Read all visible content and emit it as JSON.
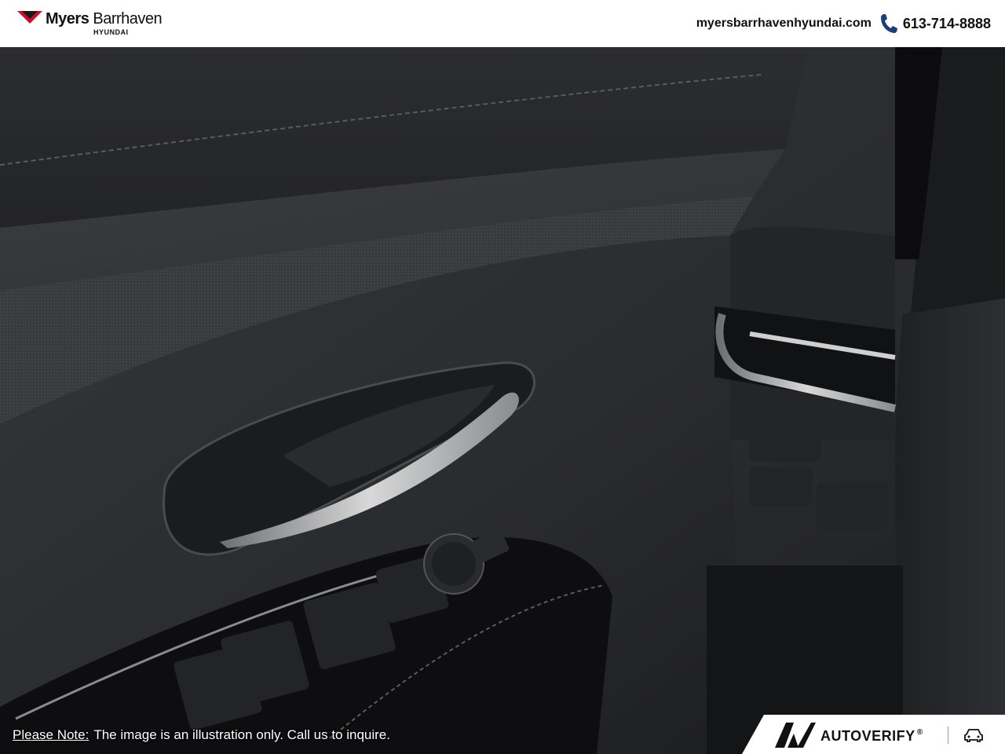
{
  "header": {
    "logo": {
      "name_bold": "Myers",
      "name_regular": "Barrhaven",
      "sub": "HYUNDAI"
    },
    "website": "myersbarrhavenhyundai.com",
    "phone": "613-714-8888",
    "phone_icon": "phone-icon"
  },
  "photo": {
    "subject": "car-interior-door-panel",
    "dominant_colors": [
      "#2a2b2e",
      "#3a3c40",
      "#b8b8b8"
    ]
  },
  "note": {
    "label": "Please Note:",
    "text": "The image is an illustration only. Call us to inquire."
  },
  "badge": {
    "brand": "AUTOVERIFY",
    "registered_mark": "®",
    "icon": "car-icon"
  }
}
